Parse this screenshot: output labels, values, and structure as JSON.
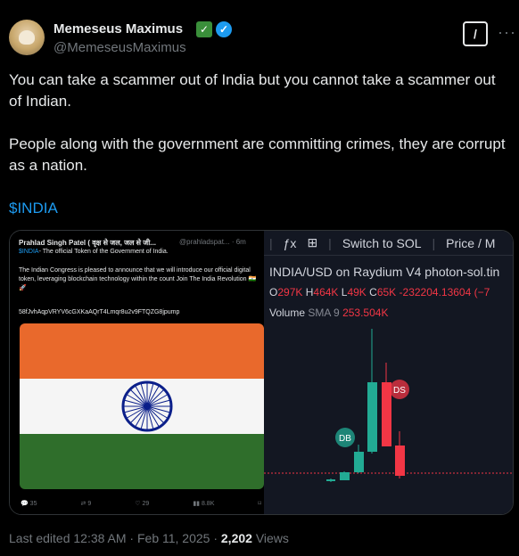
{
  "author": {
    "name": "Memeseus Maximus",
    "handle": "@MemeseusMaximus"
  },
  "tweet": {
    "paragraph1": "You can take a scammer out of India but you cannot take a scammer out of Indian.",
    "paragraph2": "People along with the government are committing crimes, they are corrupt as a nation.",
    "cashtag": "$INDIA"
  },
  "embed": {
    "name": "Prahlad Singh Patel ( वृक्ष से जल, जल से जी...",
    "handle": "@prahladspat... · 6m",
    "sub_tag": "$INDIA",
    "sub_text": "- The official Token of the Government of India.",
    "body": "The Indian Congress is pleased to announce that we will introduce our official digital token, leveraging blockchain technology within the count Join The India Revolution 🇮🇳🚀",
    "address": "58fJvhAqpVRYV6cGXKaAQrT4Lmqr8u2v9FTQZG8jpump",
    "actions": {
      "replies": "35",
      "reposts": "9",
      "likes": "29",
      "views": "8.8K"
    }
  },
  "chart": {
    "toolbar": {
      "fx": "ƒx",
      "switch": "Switch to SOL",
      "price": "Price / M"
    },
    "pair": "INDIA/USD on Raydium V4 photon-sol.tin",
    "ohlc": {
      "o_label": "O",
      "o": "297K",
      "h_label": "H",
      "h": "464K",
      "l_label": "L",
      "l": "49K",
      "c_label": "C",
      "c": "65K",
      "change": "-232204.13604 (−7"
    },
    "volume": {
      "label": "Volume",
      "sma": "SMA 9",
      "value": "253.504K"
    },
    "markers": {
      "buy": "DB",
      "sell": "DS"
    },
    "colors": {
      "up": "#22ab94",
      "down": "#f23645",
      "bg": "#131722"
    }
  },
  "footer": {
    "edited": "Last edited 12:38 AM · Feb 11, 2025 · ",
    "views_count": "2,202",
    "views_label": " Views"
  }
}
